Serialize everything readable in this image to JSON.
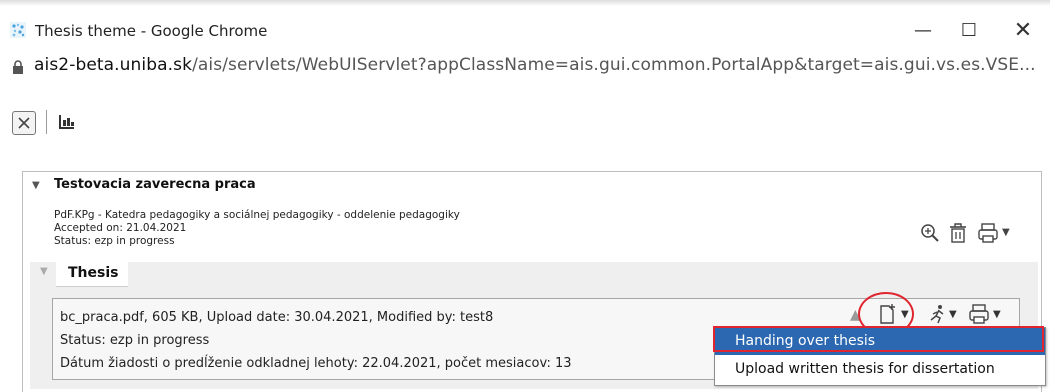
{
  "window": {
    "title": "Thesis theme - Google Chrome",
    "minimize": "—",
    "maximize": "☐",
    "close": "✕"
  },
  "address": {
    "host": "ais2-beta.uniba.sk",
    "path": "/ais/servlets/WebUIServlet?appClassName=ais.gui.common.PortalApp&target=ais.gui.vs.es.VSE..."
  },
  "toolbar": {
    "close_label": "×"
  },
  "thesis": {
    "title": "Testovacia zaverecna praca",
    "department": "PdF.KPg - Katedra pedagogiky a sociálnej pedagogiky - oddelenie pedagogiky",
    "accepted": "Accepted on: 21.04.2021",
    "status": "Status: ezp in progress"
  },
  "sub": {
    "title": "Thesis",
    "file_info": "bc_praca.pdf, 605 KB, Upload date: 30.04.2021, Modified by: test8",
    "status": "Status: ezp in progress",
    "extension": "Dátum žiadosti o predĺženie odkladnej lehoty: 22.04.2021, počet mesiacov: 13"
  },
  "menu": {
    "items": [
      {
        "label": "Handing over thesis"
      },
      {
        "label": "Upload written thesis for dissertation"
      }
    ]
  },
  "colors": {
    "menu_highlight": "#2b68b1",
    "annotation_red": "#e0252f"
  }
}
